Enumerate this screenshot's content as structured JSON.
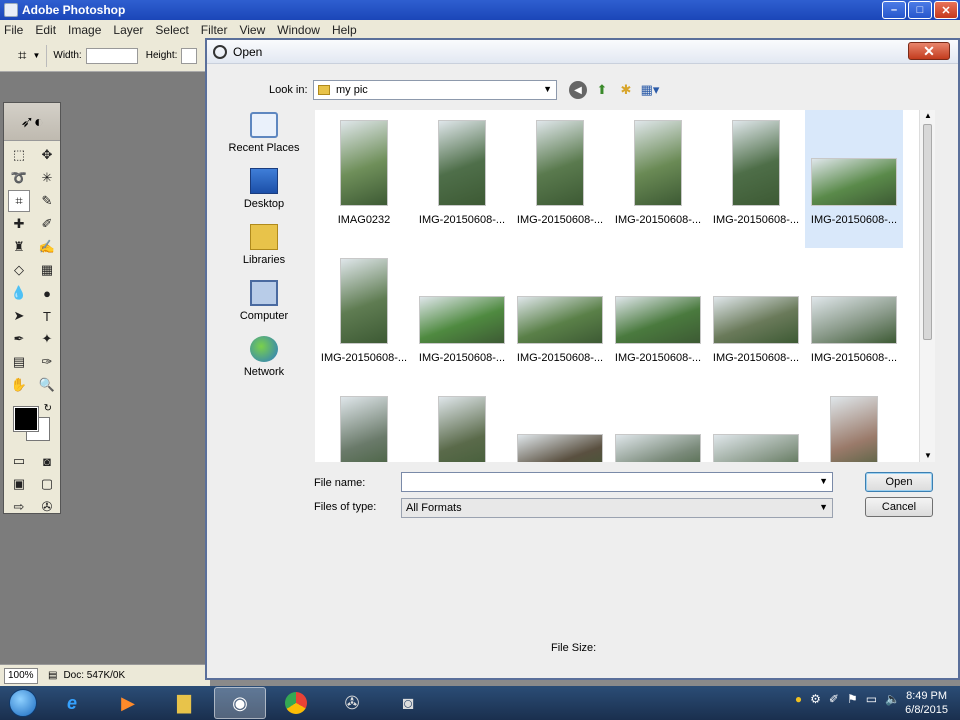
{
  "app": {
    "title": "Adobe Photoshop",
    "menu": [
      "File",
      "Edit",
      "Image",
      "Layer",
      "Select",
      "Filter",
      "View",
      "Window",
      "Help"
    ],
    "options": {
      "width_label": "Width:",
      "height_label": "Height:"
    },
    "status": {
      "zoom": "100%",
      "doc": "Doc: 547K/0K"
    }
  },
  "dialog": {
    "title": "Open",
    "look_in_label": "Look in:",
    "look_in_value": "my pic",
    "places": [
      {
        "label": "Recent Places",
        "icon": "recent-places-icon"
      },
      {
        "label": "Desktop",
        "icon": "desktop-icon"
      },
      {
        "label": "Libraries",
        "icon": "libraries-icon"
      },
      {
        "label": "Computer",
        "icon": "computer-icon"
      },
      {
        "label": "Network",
        "icon": "network-icon"
      }
    ],
    "files": [
      {
        "label": "IMAG0232",
        "orient": "portrait",
        "color": "#6f8f5a"
      },
      {
        "label": "IMG-20150608-...",
        "orient": "portrait",
        "color": "#4f6f4a"
      },
      {
        "label": "IMG-20150608-...",
        "orient": "portrait",
        "color": "#5a7a4e"
      },
      {
        "label": "IMG-20150608-...",
        "orient": "portrait",
        "color": "#6a8a55"
      },
      {
        "label": "IMG-20150608-...",
        "orient": "portrait",
        "color": "#4e6e48"
      },
      {
        "label": "IMG-20150608-...",
        "orient": "landscape",
        "color": "#5a8a4a"
      },
      {
        "label": "IMG-20150608-...",
        "orient": "portrait",
        "color": "#5f7c52"
      },
      {
        "label": "IMG-20150608-...",
        "orient": "landscape",
        "color": "#4f8a40"
      },
      {
        "label": "IMG-20150608-...",
        "orient": "landscape",
        "color": "#5a8048"
      },
      {
        "label": "IMG-20150608-...",
        "orient": "landscape",
        "color": "#4a7a3e"
      },
      {
        "label": "IMG-20150608-...",
        "orient": "landscape",
        "color": "#6a7a5a"
      },
      {
        "label": "IMG-20150608-...",
        "orient": "landscape",
        "color": "#8a9a8a"
      },
      {
        "label": "",
        "orient": "portrait",
        "color": "#6a7a6a"
      },
      {
        "label": "",
        "orient": "portrait",
        "color": "#5a6a4a"
      },
      {
        "label": "",
        "orient": "landscape",
        "color": "#5a5040"
      },
      {
        "label": "",
        "orient": "landscape",
        "color": "#7a8a7a"
      },
      {
        "label": "",
        "orient": "landscape",
        "color": "#8a9a8a"
      },
      {
        "label": "",
        "orient": "portrait",
        "color": "#9a7a6a"
      }
    ],
    "selected_index": 5,
    "file_name_label": "File name:",
    "file_name_value": "",
    "files_of_type_label": "Files of type:",
    "files_of_type_value": "All Formats",
    "open_label": "Open",
    "cancel_label": "Cancel",
    "file_size_label": "File Size:"
  },
  "taskbar": {
    "time": "8:49 PM",
    "date": "6/8/2015"
  }
}
